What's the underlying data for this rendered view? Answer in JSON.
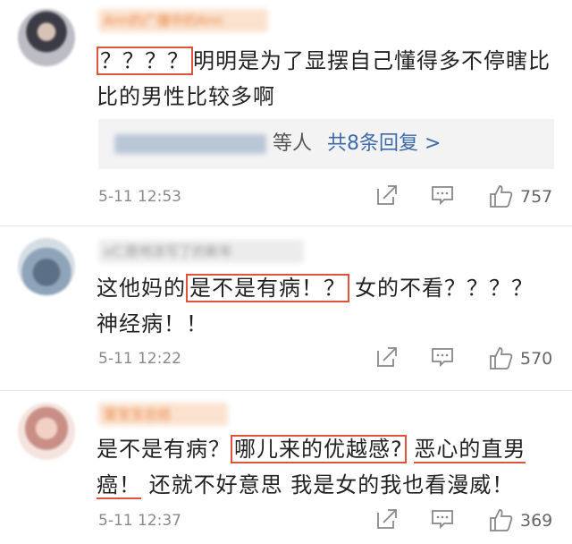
{
  "comments": [
    {
      "username": "Ann的广播中的Ann",
      "body_highlight": "？？？？",
      "body_rest": "明明是为了显摆自己懂得多不停瞎比比的男性比较多啊",
      "reply": {
        "suffix": "等人",
        "link": "共8条回复 >"
      },
      "time": "5-11 12:53",
      "likes": "757"
    },
    {
      "username": "o仁慈地涂写了的新年",
      "body_prefix": "这他妈的",
      "body_highlight": "是不是有病！？",
      "body_rest": "女的不看？？？？神经病！！",
      "time": "5-11 12:22",
      "likes": "570"
    },
    {
      "username": "雷宝宝总结",
      "body_prefix": "是不是有病？",
      "body_highlight": "哪儿来的优越感?",
      "body_under": "恶心的直男",
      "body_under2": "癌！",
      "body_rest": "还就不好意思 我是女的我也看漫威！",
      "time": "5-11 12:37",
      "likes": "369"
    }
  ],
  "icons": {
    "share": "share-icon",
    "comment": "comment-icon",
    "like": "like-icon"
  },
  "colors": {
    "highlight": "#e2523a",
    "link": "#3d6aa8"
  }
}
